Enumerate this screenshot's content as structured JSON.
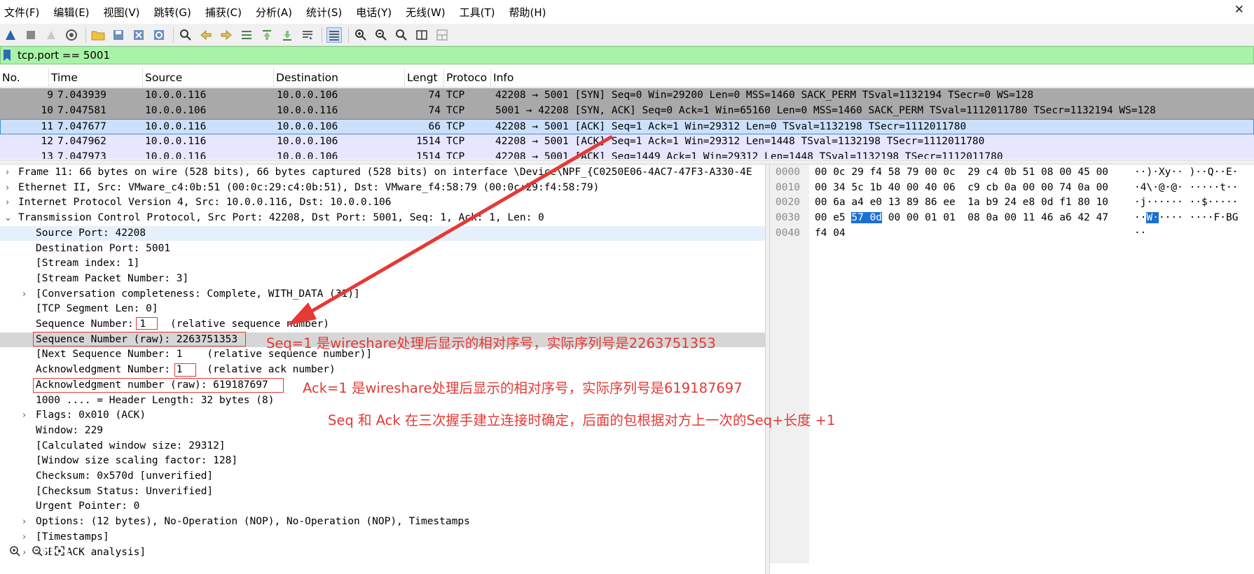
{
  "menu": [
    "文件(F)",
    "编辑(E)",
    "视图(V)",
    "跳转(G)",
    "捕获(C)",
    "分析(A)",
    "统计(S)",
    "电话(Y)",
    "无线(W)",
    "工具(T)",
    "帮助(H)"
  ],
  "window": {
    "close_glyph": "✕"
  },
  "filter": {
    "value": "tcp.port == 5001"
  },
  "packet_list": {
    "columns": [
      "No.",
      "Time",
      "Source",
      "Destination",
      "Lengt",
      "Protoco",
      "Info"
    ],
    "rows": [
      {
        "no": "9",
        "time": "7.043939",
        "source": "10.0.0.116",
        "destination": "10.0.0.106",
        "length": "74",
        "protocol": "TCP",
        "info": "42208 → 5001 [SYN] Seq=0 Win=29200 Len=0 MSS=1460 SACK_PERM TSval=1132194 TSecr=0 WS=128"
      },
      {
        "no": "10",
        "time": "7.047581",
        "source": "10.0.0.106",
        "destination": "10.0.0.116",
        "length": "74",
        "protocol": "TCP",
        "info": "5001 → 42208 [SYN, ACK] Seq=0 Ack=1 Win=65160 Len=0 MSS=1460 SACK_PERM TSval=1112011780 TSecr=1132194 WS=128"
      },
      {
        "no": "11",
        "time": "7.047677",
        "source": "10.0.0.116",
        "destination": "10.0.0.106",
        "length": "66",
        "protocol": "TCP",
        "info": "42208 → 5001 [ACK] Seq=1 Ack=1 Win=29312 Len=0 TSval=1132198 TSecr=1112011780"
      },
      {
        "no": "12",
        "time": "7.047962",
        "source": "10.0.0.116",
        "destination": "10.0.0.106",
        "length": "1514",
        "protocol": "TCP",
        "info": "42208 → 5001 [ACK] Seq=1 Ack=1 Win=29312 Len=1448 TSval=1132198 TSecr=1112011780"
      },
      {
        "no": "13",
        "time": "7.047973",
        "source": "10.0.0.116",
        "destination": "10.0.0.106",
        "length": "1514",
        "protocol": "TCP",
        "info": "42208 → 5001 [ACK] Seq=1449 Ack=1 Win=29312 Len=1448 TSval=1132198 TSecr=1112011780"
      }
    ]
  },
  "details": [
    {
      "arrow": "›",
      "text": "Frame 11: 66 bytes on wire (528 bits), 66 bytes captured (528 bits) on interface \\Device\\NPF_{C0250E06-4AC7-47F3-A330-4E"
    },
    {
      "arrow": "›",
      "text": "Ethernet II, Src: VMware_c4:0b:51 (00:0c:29:c4:0b:51), Dst: VMware_f4:58:79 (00:0c:29:f4:58:79)"
    },
    {
      "arrow": "›",
      "text": "Internet Protocol Version 4, Src: 10.0.0.116, Dst: 10.0.0.106"
    },
    {
      "arrow": "⌄",
      "text": "Transmission Control Protocol, Src Port: 42208, Dst Port: 5001, Seq: 1, Ack: 1, Len: 0"
    },
    {
      "arrow": "",
      "text": "Source Port: 42208"
    },
    {
      "arrow": "",
      "text": "Destination Port: 5001"
    },
    {
      "arrow": "",
      "text": "[Stream index: 1]"
    },
    {
      "arrow": "",
      "text": "[Stream Packet Number: 3]"
    },
    {
      "arrow": "›",
      "text": "[Conversation completeness: Complete, WITH_DATA (31)]"
    },
    {
      "arrow": "",
      "text": "[TCP Segment Len: 0]"
    },
    {
      "arrow": "",
      "text": "Sequence Number: 1    (relative sequence number)"
    },
    {
      "arrow": "",
      "text": "Sequence Number (raw): 2263751353"
    },
    {
      "arrow": "",
      "text": "[Next Sequence Number: 1    (relative sequence number)]"
    },
    {
      "arrow": "",
      "text": "Acknowledgment Number: 1    (relative ack number)"
    },
    {
      "arrow": "",
      "text": "Acknowledgment number (raw): 619187697"
    },
    {
      "arrow": "",
      "text": "1000 .... = Header Length: 32 bytes (8)"
    },
    {
      "arrow": "›",
      "text": "Flags: 0x010 (ACK)"
    },
    {
      "arrow": "",
      "text": "Window: 229"
    },
    {
      "arrow": "",
      "text": "[Calculated window size: 29312]"
    },
    {
      "arrow": "",
      "text": "[Window size scaling factor: 128]"
    },
    {
      "arrow": "",
      "text": "Checksum: 0x570d [unverified]"
    },
    {
      "arrow": "",
      "text": "[Checksum Status: Unverified]"
    },
    {
      "arrow": "",
      "text": "Urgent Pointer: 0"
    },
    {
      "arrow": "›",
      "text": "Options: (12 bytes), No-Operation (NOP), No-Operation (NOP), Timestamps"
    },
    {
      "arrow": "›",
      "text": "[Timestamps]"
    },
    {
      "arrow": "›",
      "text": "[SEQ/ACK analysis]"
    }
  ],
  "bytes": [
    {
      "offset": "0000",
      "hex_a": "00 0c 29 f4 58 79 00 0c  29 c4 0b 51 08 00 45 00",
      "hex_sel": "",
      "hex_b": "",
      "ascii_a": "··)·Xy·· )··Q··E·",
      "ascii_sel": "",
      "ascii_b": ""
    },
    {
      "offset": "0010",
      "hex_a": "00 34 5c 1b 40 00 40 06  c9 cb 0a 00 00 74 0a 00",
      "hex_sel": "",
      "hex_b": "",
      "ascii_a": "·4\\·@·@· ·····t··",
      "ascii_sel": "",
      "ascii_b": ""
    },
    {
      "offset": "0020",
      "hex_a": "00 6a a4 e0 13 89 86 ee  1a b9 24 e8 0d f1 80 10",
      "hex_sel": "",
      "hex_b": "",
      "ascii_a": "·j······ ··$·····",
      "ascii_sel": "",
      "ascii_b": ""
    },
    {
      "offset": "0030",
      "hex_a": "00 e5 ",
      "hex_sel": "57 0d",
      "hex_b": " 00 00 01 01  08 0a 00 11 46 a6 42 47",
      "ascii_a": "··",
      "ascii_sel": "W·",
      "ascii_b": "···· ····F·BG"
    },
    {
      "offset": "0040",
      "hex_a": "f4 04",
      "hex_sel": "",
      "hex_b": "",
      "ascii_a": "··",
      "ascii_sel": "",
      "ascii_b": ""
    }
  ],
  "annotations": {
    "seq_note": "Seq=1 是wireshare处理后显示的相对序号，实际序列号是2263751353",
    "ack_note": "Ack=1 是wireshare处理后显示的相对序号，实际序列号是619187697",
    "handshake_note": "Seq 和 Ack 在三次握手建立连接时确定，后面的包根据对方上一次的Seq+长度 +1"
  },
  "colors": {
    "annotation_red": "#e53935",
    "filter_green": "#a7f3a7",
    "selected_row": "#cbe1fb",
    "gray_row": "#a9a9a9",
    "lavender_row": "#e7e6ff"
  }
}
